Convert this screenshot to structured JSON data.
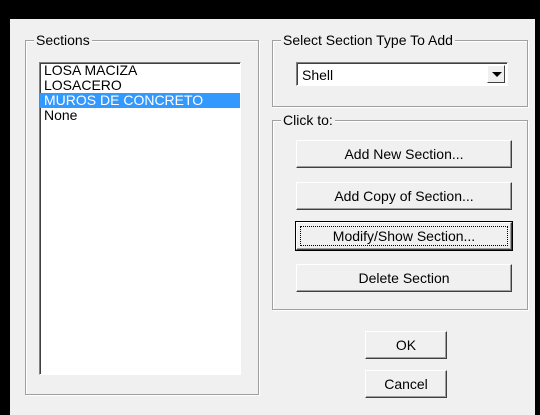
{
  "sections": {
    "legend": "Sections",
    "items": [
      "LOSA MACIZA",
      "LOSACERO",
      "MUROS DE CONCRETO",
      "None"
    ],
    "selected_index": 2
  },
  "section_type": {
    "legend": "Select Section Type To Add",
    "value": "Shell"
  },
  "click_to": {
    "legend": "Click to:",
    "add_new_label": "Add New Section...",
    "add_copy_label": "Add Copy of Section...",
    "modify_show_label": "Modify/Show Section...",
    "delete_label": "Delete Section"
  },
  "footer": {
    "ok_label": "OK",
    "cancel_label": "Cancel"
  },
  "colors": {
    "selection": "#3399ff",
    "dialog_bg": "#f0f0f0"
  }
}
